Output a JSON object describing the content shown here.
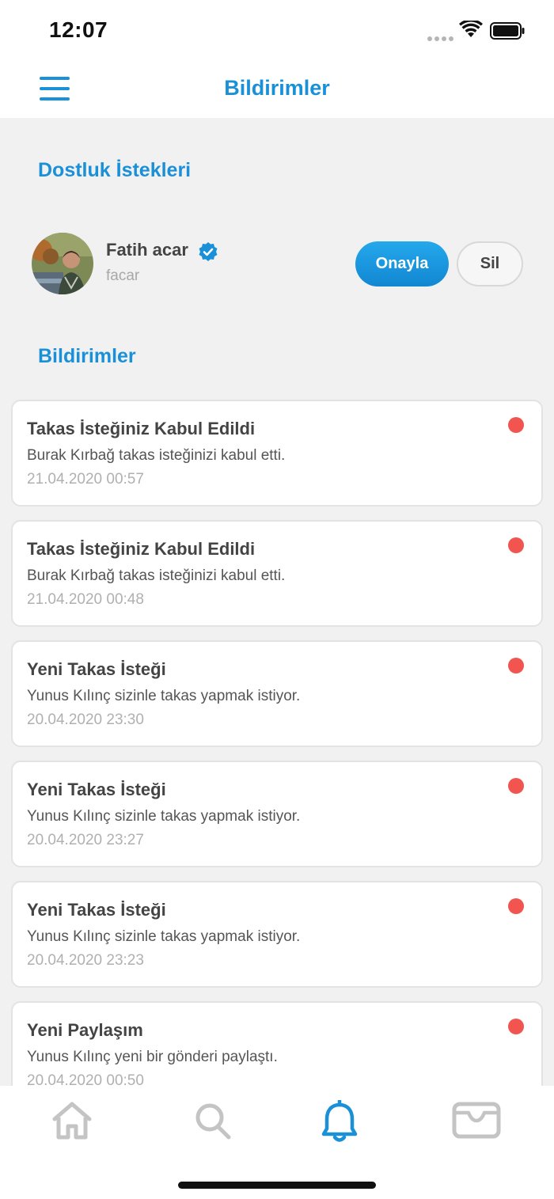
{
  "status_bar": {
    "time": "12:07"
  },
  "header": {
    "title": "Bildirimler",
    "menu_icon": "hamburger-menu-icon"
  },
  "friend_requests": {
    "section_title": "Dostluk İstekleri",
    "items": [
      {
        "name": "Fatih acar",
        "username": "facar",
        "verified": true,
        "approve_label": "Onayla",
        "delete_label": "Sil"
      }
    ]
  },
  "notifications": {
    "section_title": "Bildirimler",
    "items": [
      {
        "title": "Takas İsteğiniz Kabul Edildi",
        "body": "Burak Kırbağ takas isteğinizi kabul etti.",
        "time": "21.04.2020 00:57",
        "unread": true
      },
      {
        "title": "Takas İsteğiniz Kabul Edildi",
        "body": "Burak Kırbağ takas isteğinizi kabul etti.",
        "time": "21.04.2020 00:48",
        "unread": true
      },
      {
        "title": "Yeni Takas İsteği",
        "body": "Yunus Kılınç sizinle takas yapmak istiyor.",
        "time": "20.04.2020 23:30",
        "unread": true
      },
      {
        "title": "Yeni Takas İsteği",
        "body": "Yunus Kılınç sizinle takas yapmak istiyor.",
        "time": "20.04.2020 23:27",
        "unread": true
      },
      {
        "title": "Yeni Takas İsteği",
        "body": "Yunus Kılınç sizinle takas yapmak istiyor.",
        "time": "20.04.2020 23:23",
        "unread": true
      },
      {
        "title": "Yeni Paylaşım",
        "body": "Yunus Kılınç yeni bir gönderi paylaştı.",
        "time": "20.04.2020 00:50",
        "unread": true
      }
    ]
  },
  "tab_bar": {
    "tabs": [
      {
        "icon": "home-icon",
        "active": false
      },
      {
        "icon": "search-icon",
        "active": false
      },
      {
        "icon": "bell-icon",
        "active": true
      },
      {
        "icon": "wallet-icon",
        "active": false
      }
    ]
  },
  "colors": {
    "accent": "#1a90d8",
    "unread_dot": "#f2554f",
    "inactive_icon": "#c4c4c4",
    "background": "#f1f1f1"
  }
}
